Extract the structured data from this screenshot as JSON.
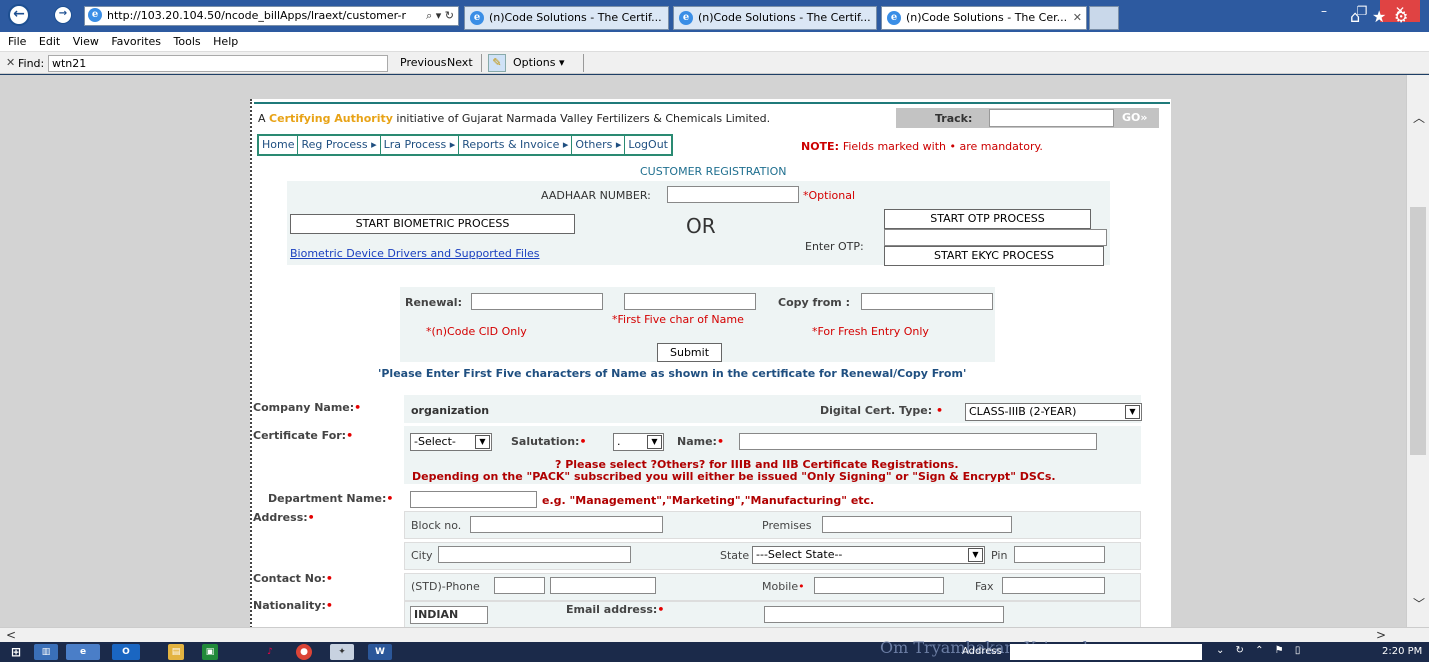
{
  "browser": {
    "url": "http://103.20.104.50/ncode_billApps/lraext/customer-r",
    "tabs": [
      "(n)Code Solutions - The Certif...",
      "(n)Code Solutions - The Certif...",
      "(n)Code Solutions - The Cer..."
    ],
    "window_controls": {
      "minimize": "–",
      "restore": "❐",
      "close": "✕"
    },
    "icons": {
      "home": "home-icon",
      "favorites": "star-icon",
      "settings": "gear-icon"
    }
  },
  "menubar": [
    "File",
    "Edit",
    "View",
    "Favorites",
    "Tools",
    "Help"
  ],
  "findbar": {
    "close": "✕",
    "label": "Find:",
    "value": "wtn21",
    "previous": "Previous",
    "next": "Next",
    "options": "Options ▾"
  },
  "header": {
    "initiative_prefix": "A",
    "initiative_highlight": "Certifying Authority",
    "initiative_suffix": "initiative of Gujarat Narmada Valley Fertilizers & Chemicals Limited.",
    "track_label": "Track:",
    "go_label": "GO»"
  },
  "nav": [
    "Home",
    "Reg Process ▸",
    "Lra Process ▸",
    "Reports & Invoice ▸",
    "Others ▸",
    "LogOut"
  ],
  "note": {
    "label": "NOTE:",
    "text": "Fields marked with • are mandatory."
  },
  "registration": {
    "title": "CUSTOMER REGISTRATION",
    "aadhaar_label": "AADHAAR NUMBER:",
    "aadhaar_optional": "*Optional",
    "biometric_button": "START BIOMETRIC PROCESS",
    "or_text": "OR",
    "otp_button": "START OTP PROCESS",
    "enter_otp_label": "Enter OTP:",
    "ekyc_button": "START EKYC PROCESS",
    "drivers_link": "Biometric Device Drivers and Supported Files"
  },
  "renewal": {
    "renewal_label": "Renewal:",
    "cid_note": "*(n)Code CID Only",
    "name_note": "*First Five char of Name",
    "copy_label": "Copy from :",
    "fresh_note": "*For Fresh Entry Only",
    "submit": "Submit",
    "instruction": "'Please Enter First Five characters of Name as shown in the certificate for Renewal/Copy From'"
  },
  "form": {
    "company_label": "Company Name:",
    "company_value": "organization",
    "cert_type_label": "Digital Cert. Type:",
    "cert_type_value": "CLASS-IIIB (2-YEAR)",
    "cert_for_label": "Certificate For:",
    "cert_for_value": "-Select-",
    "salutation_label": "Salutation:",
    "salutation_value": ".",
    "name_label": "Name:",
    "warning1": "? Please select ?Others? for IIIB and IIB Certificate Registrations.",
    "warning2": "Depending on the \"PACK\" subscribed you will either be issued \"Only Signing\" or \"Sign & Encrypt\" DSCs.",
    "dept_label": "Department Name:",
    "dept_example": "e.g. \"Management\",\"Marketing\",\"Manufacturing\" etc.",
    "address_label": "Address:",
    "block_placeholder": "Block no.",
    "premises_label": "Premises",
    "city_label": "City",
    "state_label": "State",
    "state_value": "---Select State--",
    "pin_label": "Pin",
    "contact_label": "Contact No:",
    "phone_label": "(STD)-Phone",
    "mobile_label": "Mobile",
    "fax_label": "Fax",
    "nationality_label": "Nationality:",
    "nationality_value": "INDIAN",
    "email_label": "Email address:"
  },
  "taskbar": {
    "watermark": "Om Tryambakam Yajamahe",
    "address_label": "Address",
    "clock": "2:20 PM"
  }
}
